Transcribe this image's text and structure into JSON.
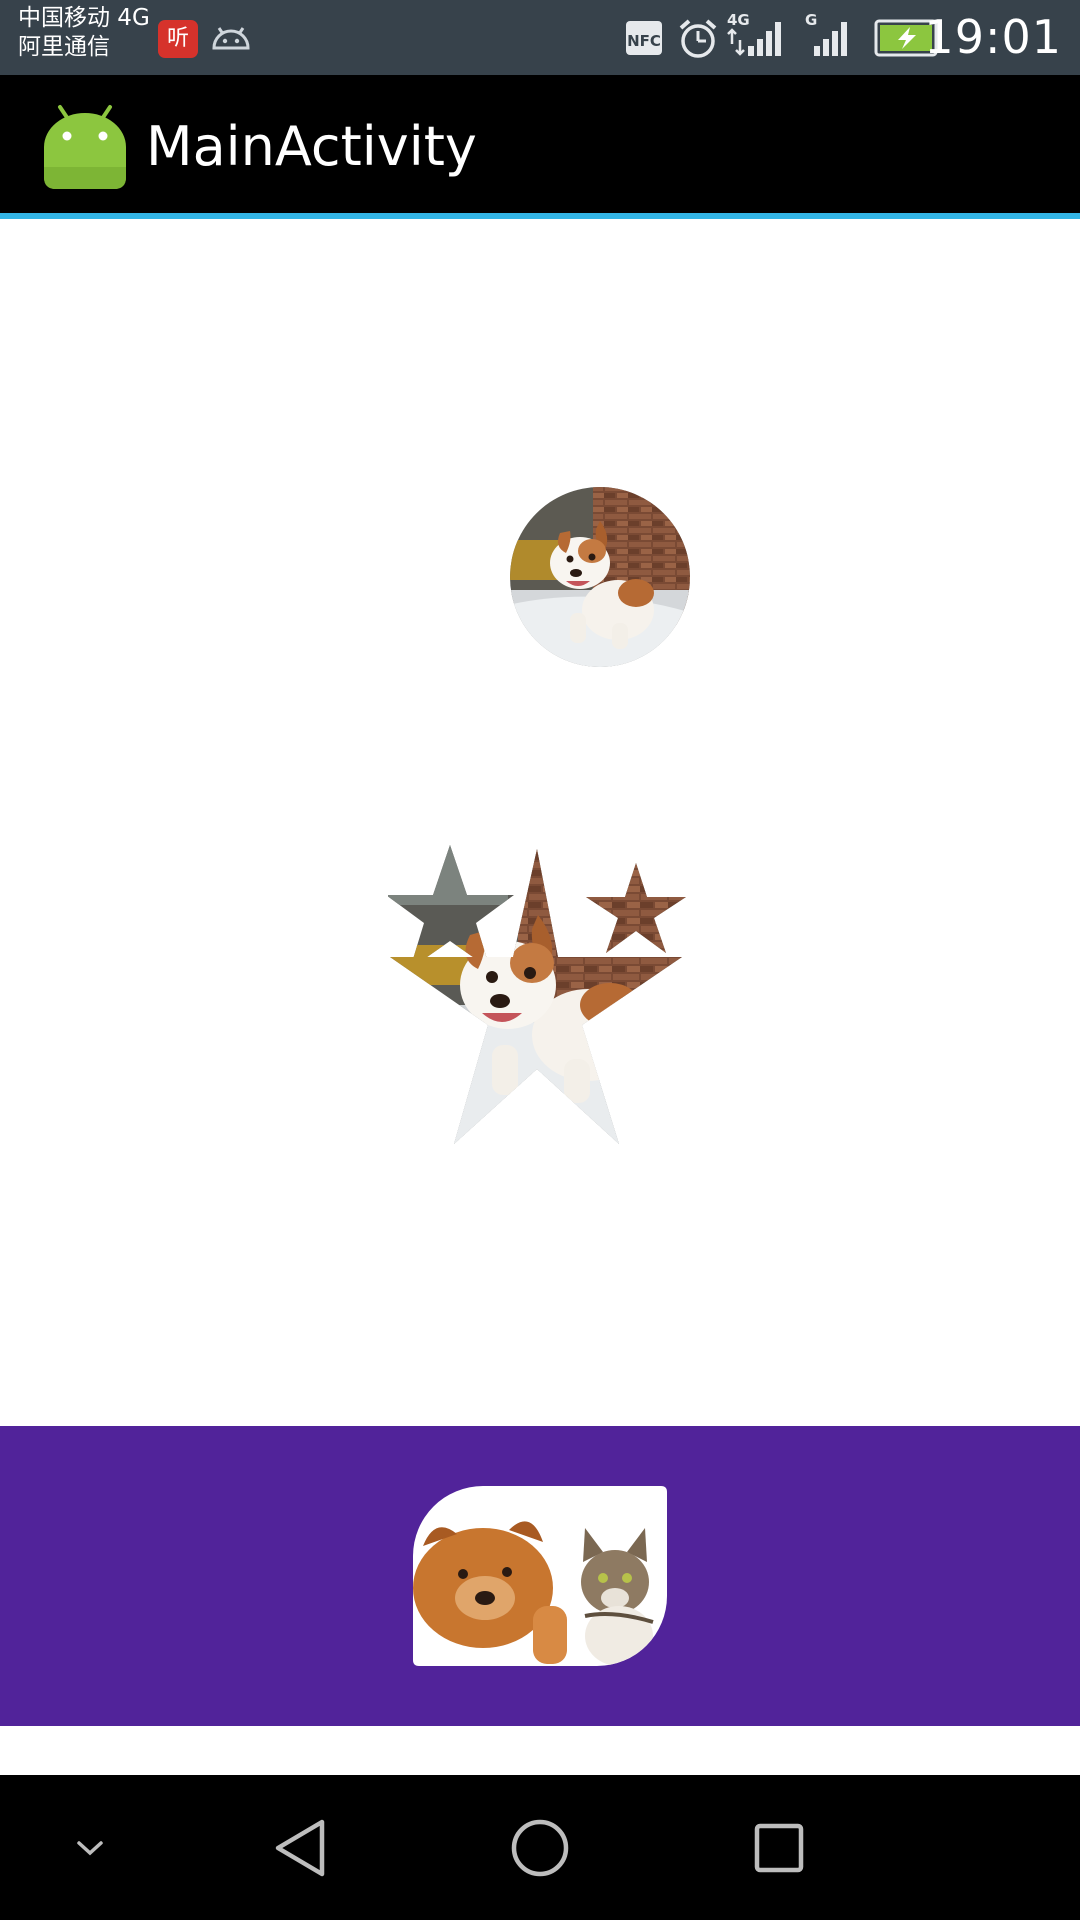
{
  "status_bar": {
    "carrier_line1": "中国移动 4G",
    "carrier_line2": "阿里通信",
    "app_badge_label": "听",
    "time": "19:01",
    "icons": [
      "ting-app-icon",
      "android-debug-icon",
      "nfc-icon",
      "alarm-icon",
      "signal-4g-icon",
      "signal-g-icon",
      "battery-charging-icon"
    ],
    "labels": {
      "nfc": "NFC",
      "sig1": "4G",
      "sig2": "G"
    }
  },
  "action_bar": {
    "title": "MainActivity",
    "icon": "android-launcher-icon",
    "accent_color": "#33b5e5"
  },
  "content": {
    "images": [
      {
        "name": "circle-puppy-image",
        "shape": "circle",
        "subject": "puppy"
      },
      {
        "name": "star-puppy-image",
        "shape": "stars",
        "subject": "puppy"
      },
      {
        "name": "rounded-dog-cat-image",
        "shape": "rounded-corner",
        "subject": "dog and cat"
      }
    ],
    "band_color": "#51239a"
  },
  "nav_bar": {
    "buttons": [
      "hide-nav-icon",
      "back-icon",
      "home-icon",
      "recents-icon"
    ]
  }
}
